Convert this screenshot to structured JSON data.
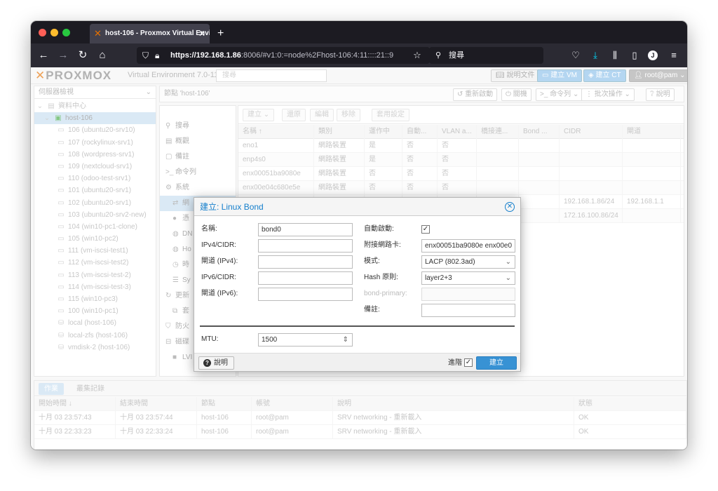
{
  "browser": {
    "tab_title": "host-106 - Proxmox Virtual Envi",
    "tab_close": "✕",
    "new_tab": "+",
    "url_host": "https://192.168.1.86",
    "url_rest": ":8006/#v1:0:=node%2Fhost-106:4:11::::21::9",
    "search_placeholder": "搜尋",
    "profile_initial": "J"
  },
  "proxmox": {
    "logo_main": "PROXMOX",
    "version": "Virtual Environment 7.0-11",
    "search_placeholder": "搜尋",
    "header_buttons": {
      "docs": "說明文件",
      "create_vm": "建立 VM",
      "create_ct": "建立 CT",
      "user": "root@pam"
    },
    "view_selector": "伺服器檢視"
  },
  "tree": {
    "datacenter": "資料中心",
    "node": "host-106",
    "items": [
      "106 (ubuntu20-srv10)",
      "107 (rockylinux-srv1)",
      "108 (wordpress-srv1)",
      "109 (nextcloud-srv1)",
      "110 (odoo-test-srv1)",
      "101 (ubuntu20-srv1)",
      "102 (ubuntu20-srv1)",
      "103 (ubuntu20-srv2-new)",
      "104 (win10-pc1-clone)",
      "105 (win10-pc2)",
      "111 (vm-iscsi-test1)",
      "112 (vm-iscsi-test2)",
      "113 (vm-iscsi-test-2)",
      "114 (vm-iscsi-test-3)",
      "115 (win10-pc3)",
      "100 (win10-pc1)"
    ],
    "storage": [
      "local (host-106)",
      "local-zfs (host-106)",
      "vmdisk-2 (host-106)"
    ]
  },
  "node_toolbar": {
    "breadcrumb": "節點 'host-106'",
    "reboot": "重新啟動",
    "shutdown": "關機",
    "shell": "命令列",
    "bulk": "批次操作",
    "help": "說明"
  },
  "node_menu": {
    "search": "搜尋",
    "summary": "概觀",
    "notes": "備註",
    "shell": "命令列",
    "system": "系統",
    "network": "網",
    "certificates": "憑",
    "dns": "DN",
    "hosts": "Ho",
    "time": "時",
    "syslog": "Sy",
    "updates": "更新",
    "repos": "套",
    "firewall": "防火",
    "disks": "磁碟",
    "lvm": "LVI"
  },
  "network_toolbar": {
    "create": "建立",
    "revert": "還原",
    "edit": "編輯",
    "remove": "移除",
    "apply": "套用設定"
  },
  "network_grid": {
    "headers": [
      "名稱 ↑",
      "類別",
      "運作中",
      "自動...",
      "VLAN a...",
      "橋接連...",
      "Bond ...",
      "CIDR",
      "閘道"
    ],
    "rows": [
      [
        "eno1",
        "網路裝置",
        "是",
        "否",
        "否",
        "",
        "",
        "",
        ""
      ],
      [
        "enp4s0",
        "網路裝置",
        "是",
        "否",
        "否",
        "",
        "",
        "",
        ""
      ],
      [
        "enx00051ba9080e",
        "網路裝置",
        "否",
        "否",
        "否",
        "",
        "",
        "",
        ""
      ],
      [
        "enx00e04c680e5e",
        "網路裝置",
        "否",
        "否",
        "否",
        "",
        "",
        "",
        ""
      ],
      [
        "",
        "",
        "",
        "",
        "",
        "",
        "",
        "192.168.1.86/24",
        "192.168.1.1"
      ],
      [
        "",
        "",
        "",
        "",
        "",
        "",
        "",
        "172.16.100.86/24",
        ""
      ]
    ]
  },
  "tasks": {
    "tab_tasks": "作業",
    "tab_cluster_log": "叢集記錄",
    "headers": [
      "開始時間 ↓",
      "結束時間",
      "節點",
      "帳號",
      "說明",
      "狀態"
    ],
    "rows": [
      [
        "十月 03 23:57:43",
        "十月 03 23:57:44",
        "host-106",
        "root@pam",
        "SRV networking - 重新載入",
        "OK"
      ],
      [
        "十月 03 22:33:23",
        "十月 03 22:33:24",
        "host-106",
        "root@pam",
        "SRV networking - 重新載入",
        "OK"
      ]
    ]
  },
  "dialog": {
    "title": "建立: Linux Bond",
    "name_label": "名稱:",
    "name_value": "bond0",
    "ipv4_label": "IPv4/CIDR:",
    "ipv4_value": "",
    "gw4_label": "閘道 (IPv4):",
    "gw4_value": "",
    "ipv6_label": "IPv6/CIDR:",
    "ipv6_value": "",
    "gw6_label": "閘道 (IPv6):",
    "gw6_value": "",
    "autostart_label": "自動啟動:",
    "autostart_checked": "✓",
    "slaves_label": "附接網路卡:",
    "slaves_value": "enx00051ba9080e enx00e0",
    "mode_label": "模式:",
    "mode_value": "LACP (802.3ad)",
    "hash_label": "Hash 原則:",
    "hash_value": "layer2+3",
    "bond_primary_label": "bond-primary:",
    "bond_primary_value": "",
    "comment_label": "備註:",
    "comment_value": "",
    "mtu_label": "MTU:",
    "mtu_value": "1500",
    "help_button": "說明",
    "advanced_label": "進階",
    "advanced_checked": "✓",
    "create_button": "建立"
  },
  "colors": {
    "accent": "#157fcc",
    "primary_button": "#3892d4",
    "logo_orange": "#e57000",
    "selection": "#c7def0"
  }
}
